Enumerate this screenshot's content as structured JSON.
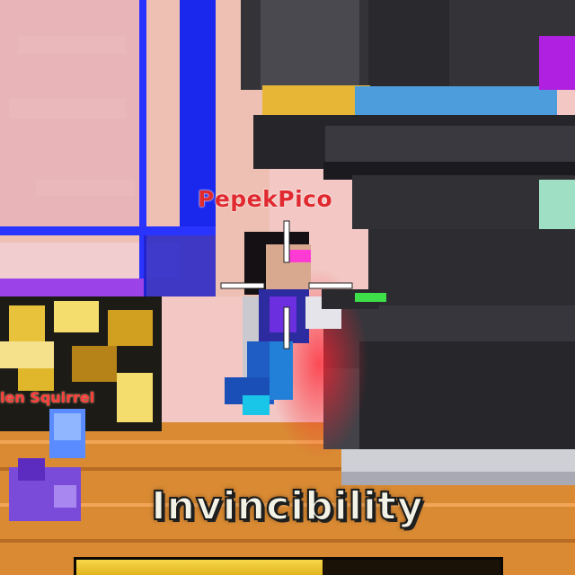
{
  "hud": {
    "player_name": "PepekPico",
    "pet_name": "len Squirrel",
    "powerup_label": "Invincibility",
    "powerup_progress": 0.58
  },
  "icons": {
    "crosshair": "crosshair-icon"
  },
  "colors": {
    "player_name": "#e02a2f",
    "powerup_fill": "#f2c62c",
    "portal_blue": "#1a2cff",
    "floor_orange": "#d9822b"
  }
}
